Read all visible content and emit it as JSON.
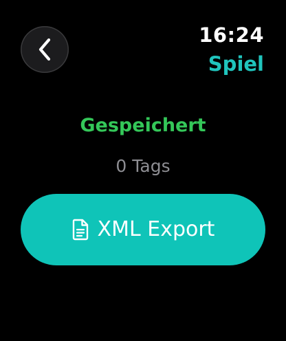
{
  "status_bar": {
    "time": "16:24",
    "app_title": "Spiel"
  },
  "navigation": {
    "back_icon": "chevron-left-icon"
  },
  "main": {
    "status_text": "Gespeichert",
    "tag_count": "0 Tags",
    "export_button": {
      "label": "XML Export",
      "icon": "document-icon"
    }
  },
  "colors": {
    "background": "#000000",
    "accent": "#0fc4b8",
    "title": "#20c4bd",
    "success": "#34c759",
    "secondary_text": "#8e8e93"
  }
}
